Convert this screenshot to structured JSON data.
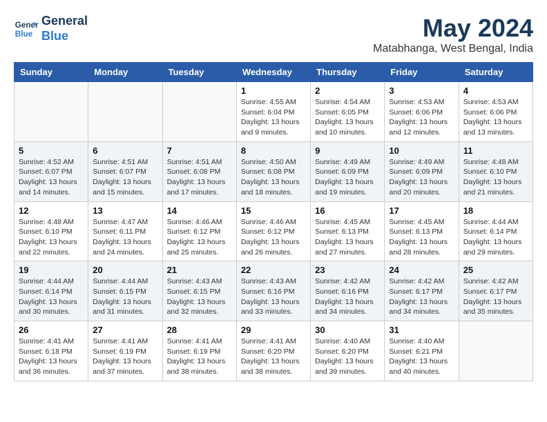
{
  "header": {
    "logo_line1": "General",
    "logo_line2": "Blue",
    "month": "May 2024",
    "location": "Matabhanga, West Bengal, India"
  },
  "weekdays": [
    "Sunday",
    "Monday",
    "Tuesday",
    "Wednesday",
    "Thursday",
    "Friday",
    "Saturday"
  ],
  "weeks": [
    [
      {
        "day": "",
        "sunrise": "",
        "sunset": "",
        "daylight": ""
      },
      {
        "day": "",
        "sunrise": "",
        "sunset": "",
        "daylight": ""
      },
      {
        "day": "",
        "sunrise": "",
        "sunset": "",
        "daylight": ""
      },
      {
        "day": "1",
        "sunrise": "Sunrise: 4:55 AM",
        "sunset": "Sunset: 6:04 PM",
        "daylight": "Daylight: 13 hours and 9 minutes."
      },
      {
        "day": "2",
        "sunrise": "Sunrise: 4:54 AM",
        "sunset": "Sunset: 6:05 PM",
        "daylight": "Daylight: 13 hours and 10 minutes."
      },
      {
        "day": "3",
        "sunrise": "Sunrise: 4:53 AM",
        "sunset": "Sunset: 6:06 PM",
        "daylight": "Daylight: 13 hours and 12 minutes."
      },
      {
        "day": "4",
        "sunrise": "Sunrise: 4:53 AM",
        "sunset": "Sunset: 6:06 PM",
        "daylight": "Daylight: 13 hours and 13 minutes."
      }
    ],
    [
      {
        "day": "5",
        "sunrise": "Sunrise: 4:52 AM",
        "sunset": "Sunset: 6:07 PM",
        "daylight": "Daylight: 13 hours and 14 minutes."
      },
      {
        "day": "6",
        "sunrise": "Sunrise: 4:51 AM",
        "sunset": "Sunset: 6:07 PM",
        "daylight": "Daylight: 13 hours and 15 minutes."
      },
      {
        "day": "7",
        "sunrise": "Sunrise: 4:51 AM",
        "sunset": "Sunset: 6:08 PM",
        "daylight": "Daylight: 13 hours and 17 minutes."
      },
      {
        "day": "8",
        "sunrise": "Sunrise: 4:50 AM",
        "sunset": "Sunset: 6:08 PM",
        "daylight": "Daylight: 13 hours and 18 minutes."
      },
      {
        "day": "9",
        "sunrise": "Sunrise: 4:49 AM",
        "sunset": "Sunset: 6:09 PM",
        "daylight": "Daylight: 13 hours and 19 minutes."
      },
      {
        "day": "10",
        "sunrise": "Sunrise: 4:49 AM",
        "sunset": "Sunset: 6:09 PM",
        "daylight": "Daylight: 13 hours and 20 minutes."
      },
      {
        "day": "11",
        "sunrise": "Sunrise: 4:48 AM",
        "sunset": "Sunset: 6:10 PM",
        "daylight": "Daylight: 13 hours and 21 minutes."
      }
    ],
    [
      {
        "day": "12",
        "sunrise": "Sunrise: 4:48 AM",
        "sunset": "Sunset: 6:10 PM",
        "daylight": "Daylight: 13 hours and 22 minutes."
      },
      {
        "day": "13",
        "sunrise": "Sunrise: 4:47 AM",
        "sunset": "Sunset: 6:11 PM",
        "daylight": "Daylight: 13 hours and 24 minutes."
      },
      {
        "day": "14",
        "sunrise": "Sunrise: 4:46 AM",
        "sunset": "Sunset: 6:12 PM",
        "daylight": "Daylight: 13 hours and 25 minutes."
      },
      {
        "day": "15",
        "sunrise": "Sunrise: 4:46 AM",
        "sunset": "Sunset: 6:12 PM",
        "daylight": "Daylight: 13 hours and 26 minutes."
      },
      {
        "day": "16",
        "sunrise": "Sunrise: 4:45 AM",
        "sunset": "Sunset: 6:13 PM",
        "daylight": "Daylight: 13 hours and 27 minutes."
      },
      {
        "day": "17",
        "sunrise": "Sunrise: 4:45 AM",
        "sunset": "Sunset: 6:13 PM",
        "daylight": "Daylight: 13 hours and 28 minutes."
      },
      {
        "day": "18",
        "sunrise": "Sunrise: 4:44 AM",
        "sunset": "Sunset: 6:14 PM",
        "daylight": "Daylight: 13 hours and 29 minutes."
      }
    ],
    [
      {
        "day": "19",
        "sunrise": "Sunrise: 4:44 AM",
        "sunset": "Sunset: 6:14 PM",
        "daylight": "Daylight: 13 hours and 30 minutes."
      },
      {
        "day": "20",
        "sunrise": "Sunrise: 4:44 AM",
        "sunset": "Sunset: 6:15 PM",
        "daylight": "Daylight: 13 hours and 31 minutes."
      },
      {
        "day": "21",
        "sunrise": "Sunrise: 4:43 AM",
        "sunset": "Sunset: 6:15 PM",
        "daylight": "Daylight: 13 hours and 32 minutes."
      },
      {
        "day": "22",
        "sunrise": "Sunrise: 4:43 AM",
        "sunset": "Sunset: 6:16 PM",
        "daylight": "Daylight: 13 hours and 33 minutes."
      },
      {
        "day": "23",
        "sunrise": "Sunrise: 4:42 AM",
        "sunset": "Sunset: 6:16 PM",
        "daylight": "Daylight: 13 hours and 34 minutes."
      },
      {
        "day": "24",
        "sunrise": "Sunrise: 4:42 AM",
        "sunset": "Sunset: 6:17 PM",
        "daylight": "Daylight: 13 hours and 34 minutes."
      },
      {
        "day": "25",
        "sunrise": "Sunrise: 4:42 AM",
        "sunset": "Sunset: 6:17 PM",
        "daylight": "Daylight: 13 hours and 35 minutes."
      }
    ],
    [
      {
        "day": "26",
        "sunrise": "Sunrise: 4:41 AM",
        "sunset": "Sunset: 6:18 PM",
        "daylight": "Daylight: 13 hours and 36 minutes."
      },
      {
        "day": "27",
        "sunrise": "Sunrise: 4:41 AM",
        "sunset": "Sunset: 6:19 PM",
        "daylight": "Daylight: 13 hours and 37 minutes."
      },
      {
        "day": "28",
        "sunrise": "Sunrise: 4:41 AM",
        "sunset": "Sunset: 6:19 PM",
        "daylight": "Daylight: 13 hours and 38 minutes."
      },
      {
        "day": "29",
        "sunrise": "Sunrise: 4:41 AM",
        "sunset": "Sunset: 6:20 PM",
        "daylight": "Daylight: 13 hours and 38 minutes."
      },
      {
        "day": "30",
        "sunrise": "Sunrise: 4:40 AM",
        "sunset": "Sunset: 6:20 PM",
        "daylight": "Daylight: 13 hours and 39 minutes."
      },
      {
        "day": "31",
        "sunrise": "Sunrise: 4:40 AM",
        "sunset": "Sunset: 6:21 PM",
        "daylight": "Daylight: 13 hours and 40 minutes."
      },
      {
        "day": "",
        "sunrise": "",
        "sunset": "",
        "daylight": ""
      }
    ]
  ]
}
